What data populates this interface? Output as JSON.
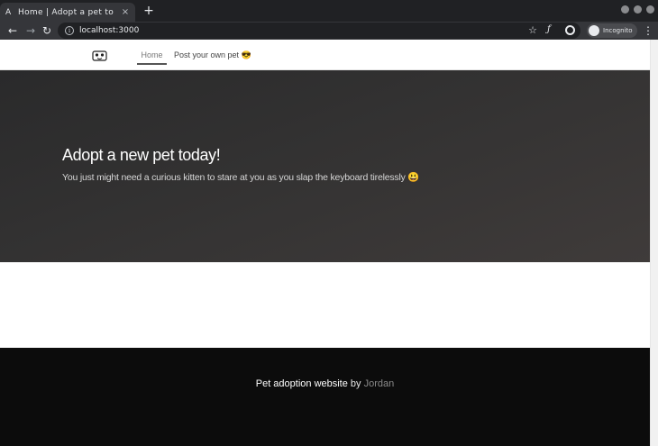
{
  "browser": {
    "tab_title": "Home | Adopt a pet to",
    "tab_favicon": "A",
    "tab_close": "×",
    "new_tab": "+",
    "url": "localhost:3000",
    "incognito_label": "Incognito",
    "ext_label": "ƒ"
  },
  "nav": {
    "home": "Home",
    "post": "Post your own pet 😎"
  },
  "hero": {
    "title": "Adopt a new pet today!",
    "subtitle": "You just might need a curious kitten to stare at you as you slap the keyboard tirelessly 😃"
  },
  "footer": {
    "text": "Pet adoption website",
    "by": " by ",
    "author": "Jordan"
  },
  "colors": {
    "hero_bg": "#2f2e2e",
    "footer_bg": "#0c0c0c",
    "chrome_bg": "#202124"
  }
}
